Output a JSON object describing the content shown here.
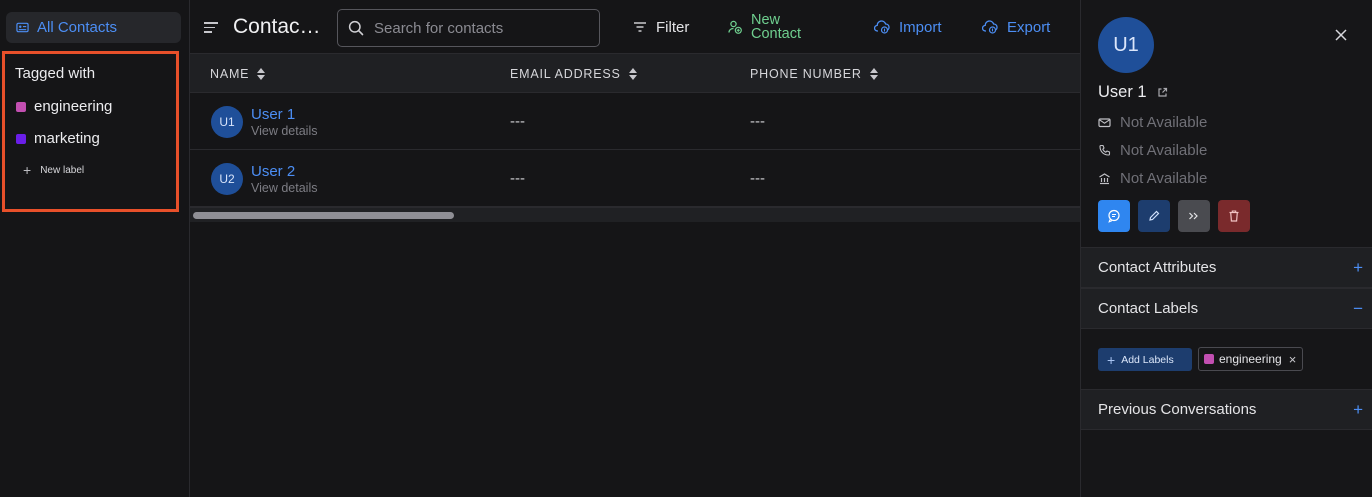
{
  "sidebar": {
    "all_contacts": "All Contacts",
    "tagged_title": "Tagged with",
    "labels": [
      {
        "name": "engineering",
        "color": "#c24fb1"
      },
      {
        "name": "marketing",
        "color": "#6a1ee8"
      }
    ],
    "new_label": "New label"
  },
  "header": {
    "title": "Contac…",
    "search_placeholder": "Search for contacts",
    "filter": "Filter",
    "new_contact_line1": "New",
    "new_contact_line2": "Contact",
    "import": "Import",
    "export": "Export"
  },
  "table": {
    "columns": [
      "NAME",
      "EMAIL ADDRESS",
      "PHONE NUMBER"
    ],
    "rows": [
      {
        "initials": "U1",
        "name": "User 1",
        "sub": "View details",
        "email": "---",
        "phone": "---"
      },
      {
        "initials": "U2",
        "name": "User 2",
        "sub": "View details",
        "email": "---",
        "phone": "---"
      }
    ]
  },
  "panel": {
    "initials": "U1",
    "name": "User 1",
    "email": "Not Available",
    "phone": "Not Available",
    "company": "Not Available",
    "sections": {
      "attributes": "Contact Attributes",
      "labels": "Contact Labels",
      "conversations": "Previous Conversations"
    },
    "toggles": {
      "attributes": "+",
      "labels": "−",
      "conversations": "+"
    },
    "add_labels": "Add Labels",
    "label_chip": "engineering"
  },
  "colors": {
    "accent": "#4c8ef4",
    "green": "#6fcf8f",
    "highlight": "#e8502a"
  }
}
